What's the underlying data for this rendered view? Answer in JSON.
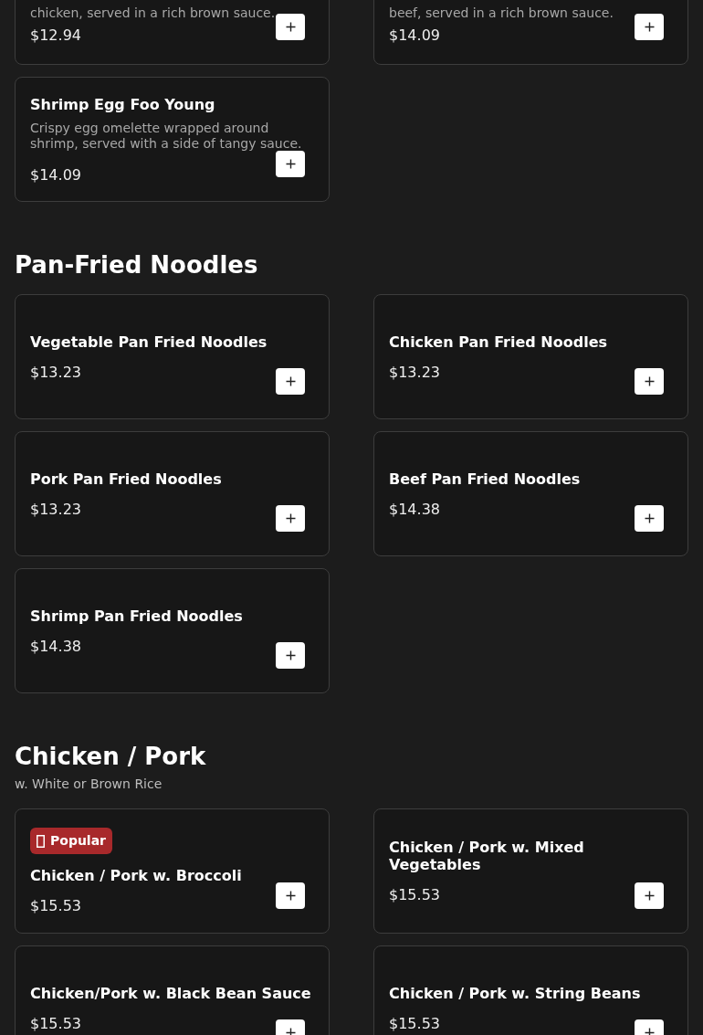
{
  "sections": [
    {
      "items": [
        {
          "description": "chicken, served in a rich brown sauce.",
          "price": "$12.94"
        },
        {
          "description": "beef, served in a rich brown sauce.",
          "price": "$14.09"
        },
        {
          "name": "Shrimp Egg Foo Young",
          "description": "Crispy egg omelette wrapped around shrimp, served with a side of tangy sauce.",
          "price": "$14.09"
        }
      ]
    },
    {
      "title": "Pan-Fried Noodles",
      "items": [
        {
          "name": "Vegetable Pan Fried Noodles",
          "price": "$13.23"
        },
        {
          "name": "Chicken Pan Fried Noodles",
          "price": "$13.23"
        },
        {
          "name": "Pork Pan Fried Noodles",
          "price": "$13.23"
        },
        {
          "name": "Beef Pan Fried Noodles",
          "price": "$14.38"
        },
        {
          "name": "Shrimp Pan Fried Noodles",
          "price": "$14.38"
        }
      ]
    },
    {
      "title": "Chicken / Pork",
      "subtitle": "w. White or Brown Rice",
      "items": [
        {
          "badge": "Popular",
          "name": "Chicken / Pork w. Broccoli",
          "price": "$15.53"
        },
        {
          "name": "Chicken / Pork w. Mixed Vegetables",
          "price": "$15.53"
        },
        {
          "name": "Chicken/Pork w. Black Bean Sauce",
          "price": "$15.53"
        },
        {
          "name": "Chicken / Pork w. String Beans",
          "price": "$15.53"
        }
      ]
    }
  ]
}
